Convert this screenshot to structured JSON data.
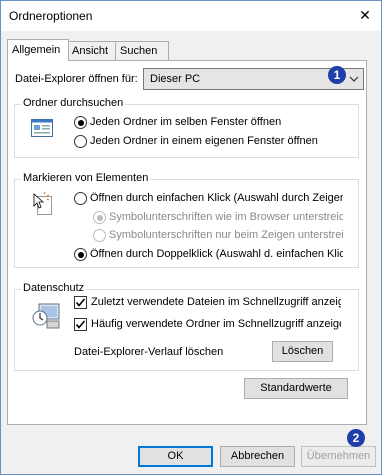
{
  "window": {
    "title": "Ordneroptionen",
    "close_symbol": "✕"
  },
  "tabs": [
    "Allgemein",
    "Ansicht",
    "Suchen"
  ],
  "explorer_open": {
    "label": "Datei-Explorer öffnen für:",
    "value": "Dieser PC"
  },
  "browse_folders": {
    "title": "Ordner durchsuchen",
    "options": [
      "Jeden Ordner im selben Fenster öffnen",
      "Jeden Ordner in einem eigenen Fenster öffnen"
    ],
    "selected_index": 0
  },
  "click_items": {
    "title": "Markieren von Elementen",
    "single_click": "Öffnen durch einfachen Klick (Auswahl durch Zeigen)",
    "sub_options": [
      "Symbolunterschriften wie im Browser unterstreichen",
      "Symbolunterschriften nur beim Zeigen unterstreichen"
    ],
    "double_click": "Öffnen durch Doppelklick (Auswahl d. einfachen Klick)",
    "selected": "double_click"
  },
  "privacy": {
    "title": "Datenschutz",
    "checkbox_recent_files": {
      "label": "Zuletzt verwendete Dateien im Schnellzugriff anzeigen",
      "checked": true
    },
    "checkbox_frequent_folders": {
      "label": "Häufig verwendete Ordner im Schnellzugriff anzeigen",
      "checked": true
    },
    "clear_history_label": "Datei-Explorer-Verlauf löschen",
    "clear_button": "Löschen"
  },
  "restore_defaults_button": "Standardwerte",
  "footer": {
    "ok": "OK",
    "cancel": "Abbrechen",
    "apply": "Übernehmen"
  },
  "badges": [
    "1",
    "2"
  ],
  "colors": {
    "accent": "#0078d7",
    "badge": "#1e3ea8"
  }
}
